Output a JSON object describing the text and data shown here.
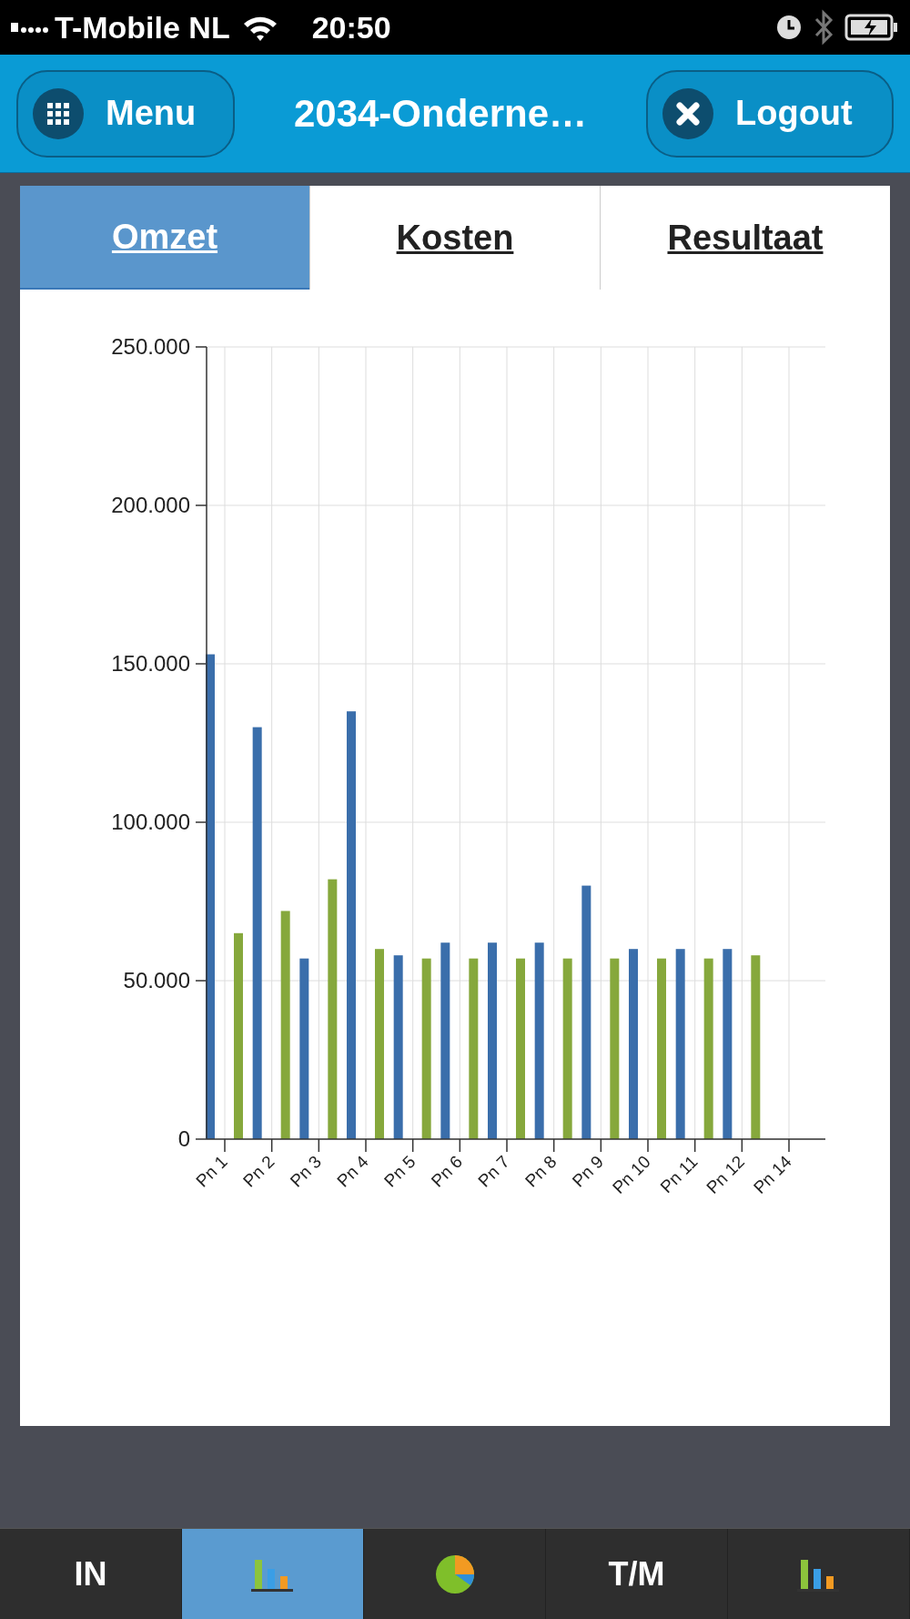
{
  "status_bar": {
    "carrier": "T-Mobile NL",
    "time": "20:50"
  },
  "header": {
    "menu_button": "Menu",
    "title": "2034-Onderne…",
    "logout_button": "Logout"
  },
  "tabs": [
    {
      "label": "Omzet",
      "selected": true
    },
    {
      "label": "Kosten",
      "selected": false
    },
    {
      "label": "Resultaat",
      "selected": false
    }
  ],
  "chart_data": {
    "type": "bar",
    "categories": [
      "Pn 1",
      "Pn 2",
      "Pn 3",
      "Pn 4",
      "Pn 5",
      "Pn 6",
      "Pn 7",
      "Pn 8",
      "Pn 9",
      "Pn 10",
      "Pn 11",
      "Pn 12",
      "Pn 14"
    ],
    "series": [
      {
        "color": "#3a6eab",
        "values": [
          153000,
          130000,
          57000,
          135000,
          58000,
          62000,
          62000,
          62000,
          80000,
          60000,
          60000,
          60000,
          null
        ]
      },
      {
        "color": "#86a83c",
        "values": [
          65000,
          72000,
          82000,
          60000,
          57000,
          57000,
          57000,
          57000,
          57000,
          57000,
          57000,
          58000,
          null
        ]
      }
    ],
    "ylim": [
      0,
      250000
    ],
    "grid": true,
    "yticks": [
      {
        "value": 0,
        "label": "0"
      },
      {
        "value": 50000,
        "label": "50.000"
      },
      {
        "value": 100000,
        "label": "100.000"
      },
      {
        "value": 150000,
        "label": "150.000"
      },
      {
        "value": 200000,
        "label": "200.000"
      },
      {
        "value": 250000,
        "label": "250.000"
      }
    ]
  },
  "bottom_tabs": [
    {
      "kind": "label",
      "label": "IN",
      "selected": false
    },
    {
      "kind": "bars",
      "selected": true
    },
    {
      "kind": "pie",
      "selected": false
    },
    {
      "kind": "label",
      "label": "T/M",
      "selected": false
    },
    {
      "kind": "bars",
      "selected": false
    }
  ]
}
